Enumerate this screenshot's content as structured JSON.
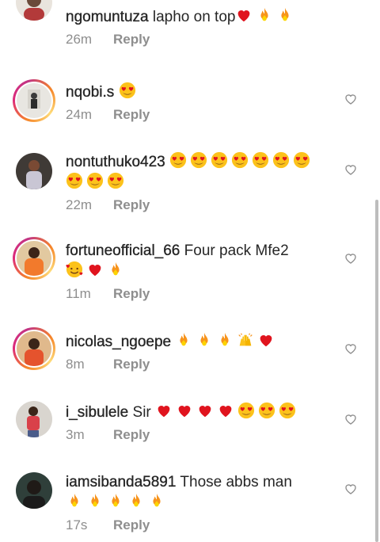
{
  "comments": [
    {
      "username": "ngomuntuza",
      "text": "lapho on top",
      "emojis": [
        "heart",
        "fire",
        "fire"
      ],
      "time": "26m",
      "reply_label": "Reply",
      "avatar_style": "partial"
    },
    {
      "username": "nqobi.s",
      "text": "",
      "emojis": [
        "heart-eyes"
      ],
      "time": "24m",
      "reply_label": "Reply",
      "avatar_style": "ring"
    },
    {
      "username": "nontuthuko423",
      "text": "",
      "emojis": [
        "heart-eyes",
        "heart-eyes",
        "heart-eyes",
        "heart-eyes",
        "heart-eyes",
        "heart-eyes",
        "heart-eyes",
        "heart-eyes",
        "heart-eyes",
        "heart-eyes"
      ],
      "time": "22m",
      "reply_label": "Reply",
      "avatar_style": "plain"
    },
    {
      "username": "fortuneofficial_66",
      "text": "Four pack Mfe2",
      "emojis": [
        "smiling-hearts",
        "heart",
        "fire"
      ],
      "time": "11m",
      "reply_label": "Reply",
      "avatar_style": "ring"
    },
    {
      "username": "nicolas_ngoepe",
      "text": "",
      "emojis": [
        "fire",
        "fire",
        "fire",
        "raised-hands",
        "heart"
      ],
      "time": "8m",
      "reply_label": "Reply",
      "avatar_style": "ring"
    },
    {
      "username": "i_sibulele",
      "text": "Sir",
      "emojis": [
        "heart",
        "heart",
        "heart",
        "heart",
        "heart-eyes",
        "heart-eyes",
        "heart-eyes"
      ],
      "time": "3m",
      "reply_label": "Reply",
      "avatar_style": "plain"
    },
    {
      "username": "iamsibanda5891",
      "text": "Those abbs man",
      "emojis": [
        "fire",
        "fire",
        "fire",
        "fire",
        "fire"
      ],
      "time": "17s",
      "reply_label": "Reply",
      "avatar_style": "plain"
    }
  ],
  "colors": {
    "text": "#262626",
    "meta": "#8e8e8e",
    "heart_red": "#e0141e",
    "ring_start": "#f58529",
    "ring_end": "#dd2a7b"
  },
  "icons": {
    "like_button": "heart-outline-icon"
  }
}
